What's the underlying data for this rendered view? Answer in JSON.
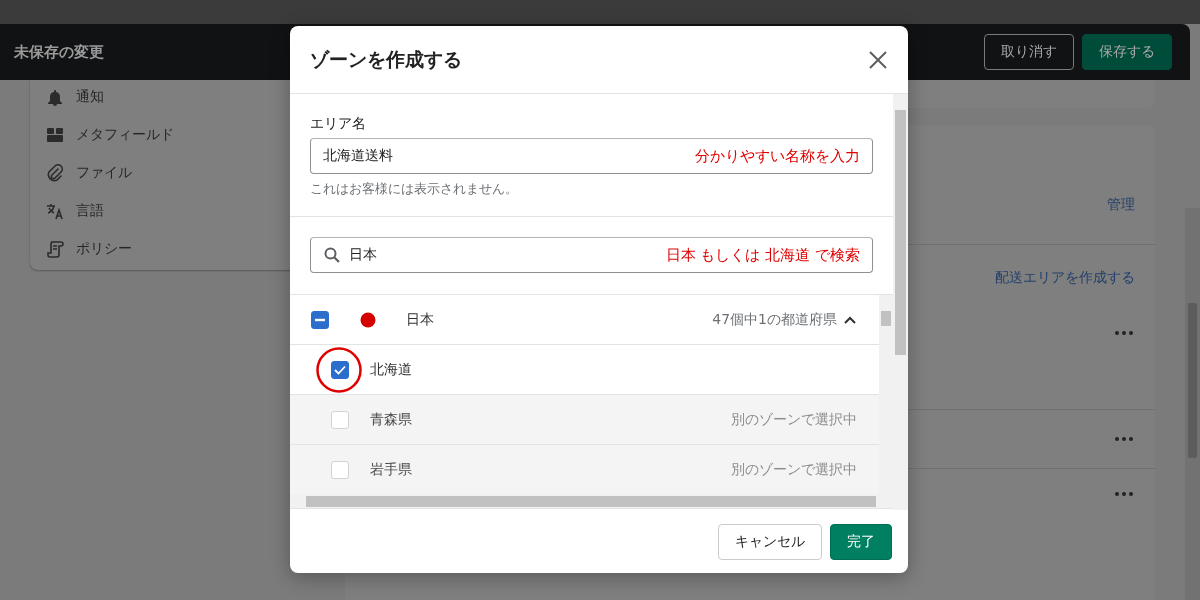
{
  "save_bar": {
    "title": "未保存の変更",
    "buttons": [
      {
        "label": "取り消す",
        "kind": "secondary"
      },
      {
        "label": "保存する",
        "kind": "primary"
      }
    ]
  },
  "sidebar": {
    "items": [
      {
        "label": "通知",
        "kind": "bell"
      },
      {
        "label": "メタフィールド",
        "kind": "blocks"
      },
      {
        "label": "ファイル",
        "kind": "clip"
      },
      {
        "label": "言語",
        "kind": "translate"
      },
      {
        "label": "ポリシー",
        "kind": "scroll"
      }
    ]
  },
  "main": {
    "manage_link": "管理",
    "create_link": "配送エリアを作成する"
  },
  "modal": {
    "title": "ゾーンを作成する",
    "name_field": {
      "label": "エリア名",
      "value": "北海道送料",
      "help": "これはお客様には表示されません。",
      "annotation": "分かりやすい名称を入力"
    },
    "search_field": {
      "value": "日本",
      "annotation": "日本 もしくは 北海道 で検索"
    },
    "country": {
      "name": "日本",
      "indeterminate": true,
      "summary": "47個中1の都道府県",
      "expanded": true
    },
    "regions": [
      {
        "name": "北海道",
        "checked": true,
        "disabled": false,
        "circled": true
      },
      {
        "name": "青森県",
        "checked": false,
        "disabled": true,
        "circled": false,
        "note": "別のゾーンで選択中"
      },
      {
        "name": "岩手県",
        "checked": false,
        "disabled": true,
        "circled": false,
        "note": "別のゾーンで選択中"
      }
    ],
    "buttons": [
      {
        "label": "キャンセル",
        "kind": "secondary"
      },
      {
        "label": "完了",
        "kind": "primary"
      }
    ]
  }
}
